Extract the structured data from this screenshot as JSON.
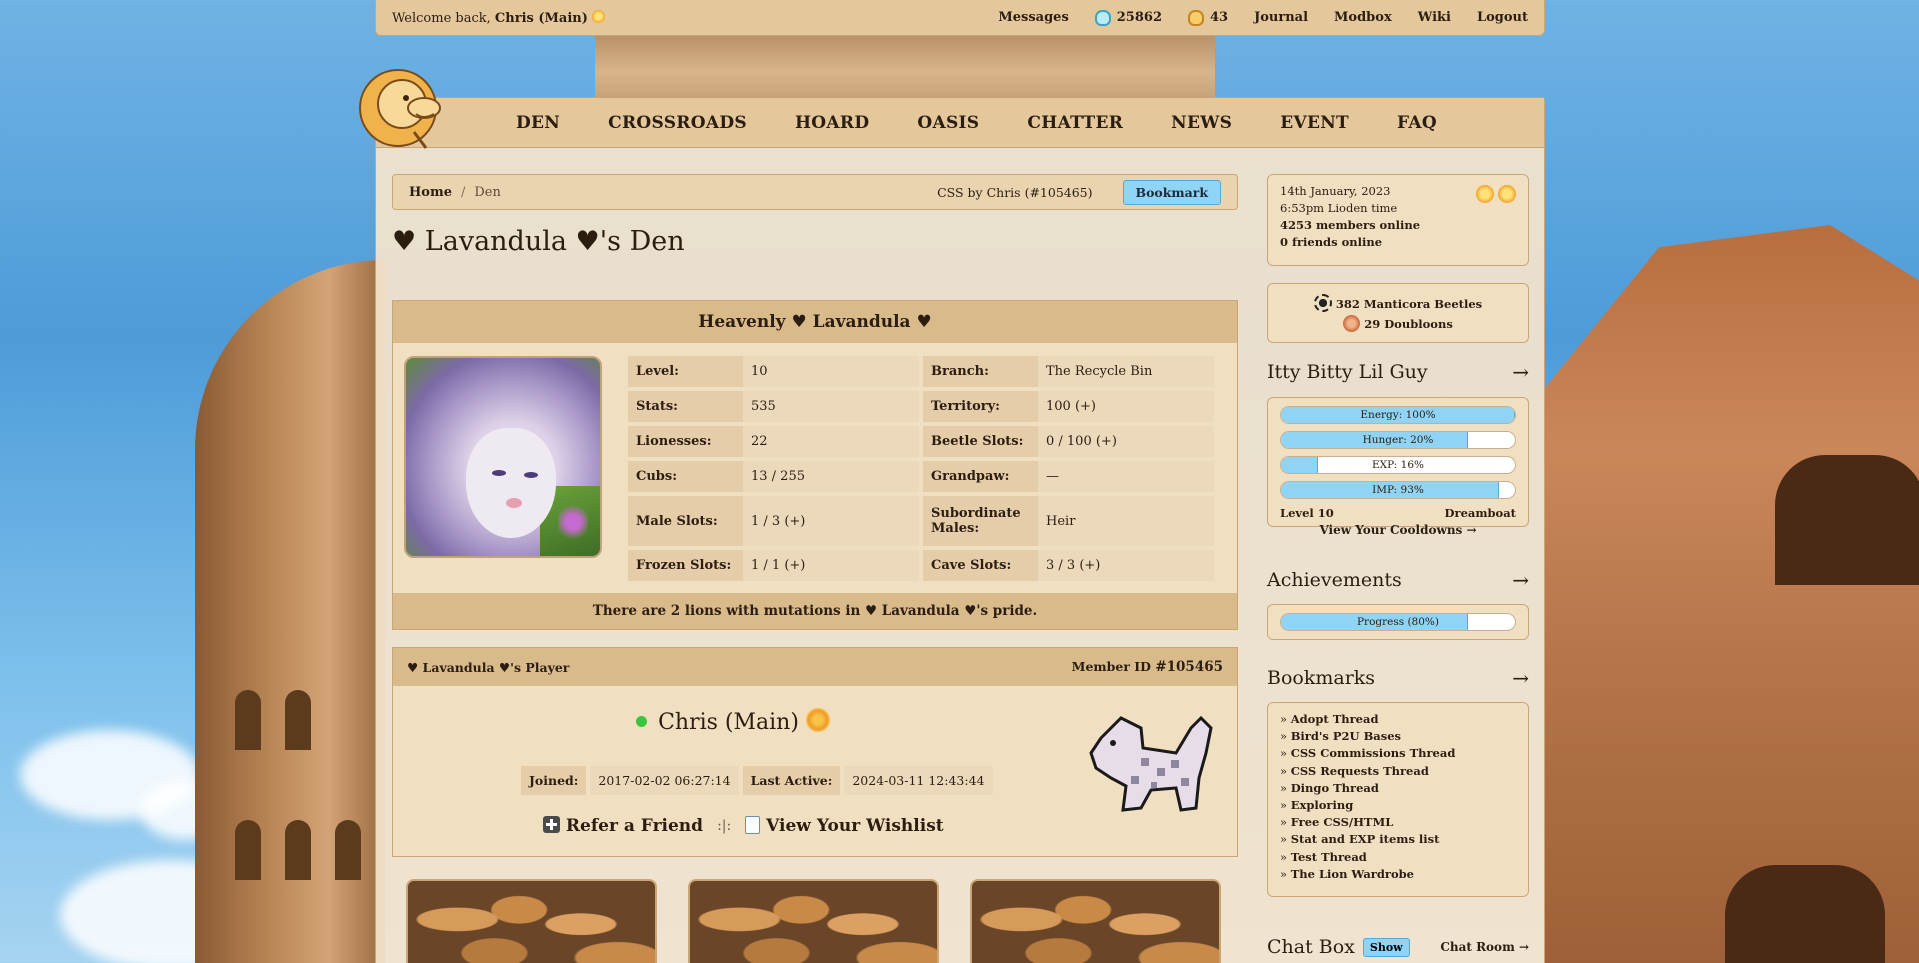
{
  "topbar": {
    "welcome_prefix": "Welcome back,",
    "username": "Chris (Main)",
    "links": {
      "messages": "Messages",
      "beetles_count": "25862",
      "gold_beetles_count": "43",
      "journal": "Journal",
      "modbox": "Modbox",
      "wiki": "Wiki",
      "logout": "Logout"
    }
  },
  "nav": {
    "items": [
      "DEN",
      "CROSSROADS",
      "HOARD",
      "OASIS",
      "CHATTER",
      "NEWS",
      "EVENT",
      "FAQ"
    ]
  },
  "breadcrumb": {
    "home": "Home",
    "separator": "/",
    "current": "Den",
    "css_credit": "CSS by Chris (#105465)",
    "bookmark_button": "Bookmark"
  },
  "page_title": "♥ Lavandula ♥'s Den",
  "den": {
    "lion_name": "Heavenly ♥ Lavandula ♥",
    "stats": [
      {
        "label": "Level:",
        "value": "10",
        "label2": "Branch:",
        "value2": "The Recycle Bin"
      },
      {
        "label": "Stats:",
        "value": "535",
        "label2": "Territory:",
        "value2": "100 (+)"
      },
      {
        "label": "Lionesses:",
        "value": "22",
        "label2": "Beetle Slots:",
        "value2": "0 / 100 (+)"
      },
      {
        "label": "Cubs:",
        "value": "13 / 255",
        "label2": "Grandpaw:",
        "value2": "—"
      },
      {
        "label": "Male Slots:",
        "value": "1 / 3 (+)",
        "label2": "Subordinate Males:",
        "value2": "Heir"
      },
      {
        "label": "Frozen Slots:",
        "value": "1 / 1 (+)",
        "label2": "Cave Slots:",
        "value2": "3 / 3 (+)"
      }
    ],
    "footer": "There are 2 lions with mutations in ♥ Lavandula ♥'s pride."
  },
  "player": {
    "header_left": "♥ Lavandula ♥'s Player",
    "member_id_label": "Member ID",
    "member_id": "#105465",
    "name": "Chris (Main)",
    "joined_label": "Joined:",
    "joined_value": "2017-02-02 06:27:14",
    "last_active_label": "Last Active:",
    "last_active_value": "2024-03-11 12:43:44",
    "refer_label": "Refer a Friend",
    "divider": ":|:",
    "wishlist_label": "View Your Wishlist"
  },
  "sidebar": {
    "date": "14th January, 2023",
    "time": "6:53pm Lioden time",
    "members_online": "4253 members online",
    "friends_online": "0 friends online",
    "currency": {
      "beetles": "382 Manticora Beetles",
      "doubloons": "29 Doubloons"
    },
    "cub": {
      "title": "Itty Bitty Lil Guy",
      "arrow": "→",
      "bars": [
        {
          "label": "Energy: 100%",
          "value": 100
        },
        {
          "label": "Hunger: 20%",
          "value": 80
        },
        {
          "label": "EXP: 16%",
          "value": 16
        },
        {
          "label": "IMP: 93%",
          "value": 93
        }
      ],
      "level": "Level 10",
      "title_rank": "Dreamboat",
      "cooldowns_link": "View Your Cooldowns →"
    },
    "achievements": {
      "title": "Achievements",
      "arrow": "→",
      "progress_label": "Progress (80%)",
      "progress": 80
    },
    "bookmarks": {
      "title": "Bookmarks",
      "arrow": "→",
      "items": [
        "Adopt Thread",
        "Bird's P2U Bases",
        "CSS Commissions Thread",
        "CSS Requests Thread",
        "Dingo Thread",
        "Exploring",
        "Free CSS/HTML",
        "Stat and EXP items list",
        "Test Thread",
        "The Lion Wardrobe"
      ]
    },
    "chat": {
      "title": "Chat Box",
      "show_button": "Show",
      "room_link": "Chat Room →"
    }
  },
  "colors": {
    "accent_blue": "#8fd3f5",
    "panel_tan": "#e4c89c",
    "online_green": "#3cc43c"
  }
}
